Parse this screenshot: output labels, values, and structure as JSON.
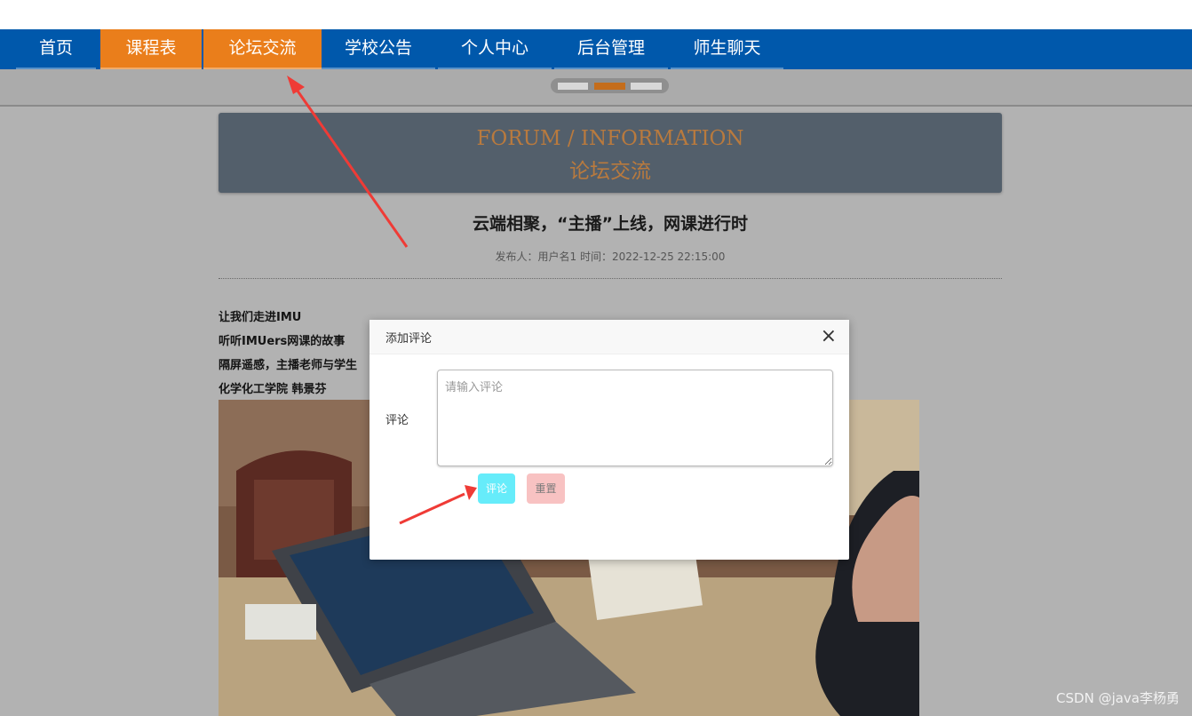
{
  "nav": {
    "items": [
      {
        "label": "首页",
        "active": false
      },
      {
        "label": "课程表",
        "active": true
      },
      {
        "label": "论坛交流",
        "active": true
      },
      {
        "label": "学校公告",
        "active": false
      },
      {
        "label": "个人中心",
        "active": false
      },
      {
        "label": "后台管理",
        "active": false
      },
      {
        "label": "师生聊天",
        "active": false
      }
    ]
  },
  "banner": {
    "en": "FORUM / INFORMATION",
    "cn": "论坛交流"
  },
  "article": {
    "title": "云端相聚，“主播”上线，网课进行时",
    "meta": "发布人：用户名1 时间：2022-12-25 22:15:00",
    "paragraphs": [
      "让我们走进IMU",
      "听听IMUers网课的故事",
      "隔屏遥感，主播老师与学生",
      "化学化工学院 韩景芬"
    ]
  },
  "modal": {
    "title": "添加评论",
    "close": "×",
    "field_label": "评论",
    "placeholder": "请输入评论",
    "value": "",
    "submit_label": "评论",
    "reset_label": "重置"
  },
  "watermark": "CSDN @java李杨勇",
  "colors": {
    "nav_bg": "#0058ab",
    "nav_active": "#ea7e1b",
    "overlay": "#b2b2b2",
    "submit_btn": "#66ecfa",
    "reset_btn": "#f8c2c2",
    "annotation_arrow": "#ef3b36"
  }
}
